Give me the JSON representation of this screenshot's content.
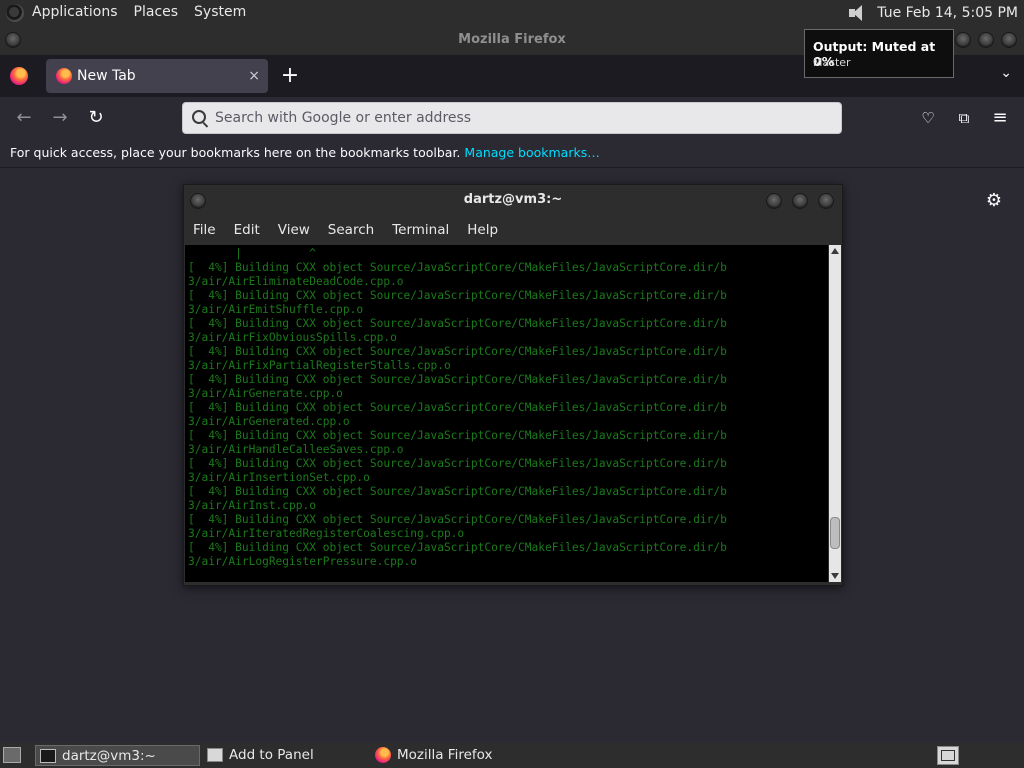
{
  "top_panel": {
    "menus": [
      "Applications",
      "Places",
      "System"
    ],
    "clock": "Tue Feb 14,  5:05 PM"
  },
  "volume_tooltip": {
    "title": "Output: Muted at 0%",
    "subtitle": "Master"
  },
  "firefox": {
    "window_title": "Mozilla Firefox",
    "tab_title": "New Tab",
    "tab_close": "×",
    "new_tab": "+",
    "list_all_tabs": "⌄",
    "nav": {
      "back": "←",
      "forward": "→",
      "reload": "↻"
    },
    "urlbar_placeholder": "Search with Google or enter address",
    "toolbar": {
      "pocket": "♡",
      "extensions": "⧉",
      "menu": "≡"
    },
    "bookmarks_bar_text": "For quick access, place your bookmarks here on the bookmarks toolbar.",
    "bookmarks_bar_link": "Manage bookmarks…",
    "settings_icon": "⚙"
  },
  "terminal": {
    "title": "dartz@vm3:~",
    "menus": [
      "File",
      "Edit",
      "View",
      "Search",
      "Terminal",
      "Help"
    ],
    "output": "       |          ^\n[  4%] Building CXX object Source/JavaScriptCore/CMakeFiles/JavaScriptCore.dir/b\n3/air/AirEliminateDeadCode.cpp.o\n[  4%] Building CXX object Source/JavaScriptCore/CMakeFiles/JavaScriptCore.dir/b\n3/air/AirEmitShuffle.cpp.o\n[  4%] Building CXX object Source/JavaScriptCore/CMakeFiles/JavaScriptCore.dir/b\n3/air/AirFixObviousSpills.cpp.o\n[  4%] Building CXX object Source/JavaScriptCore/CMakeFiles/JavaScriptCore.dir/b\n3/air/AirFixPartialRegisterStalls.cpp.o\n[  4%] Building CXX object Source/JavaScriptCore/CMakeFiles/JavaScriptCore.dir/b\n3/air/AirGenerate.cpp.o\n[  4%] Building CXX object Source/JavaScriptCore/CMakeFiles/JavaScriptCore.dir/b\n3/air/AirGenerated.cpp.o\n[  4%] Building CXX object Source/JavaScriptCore/CMakeFiles/JavaScriptCore.dir/b\n3/air/AirHandleCalleeSaves.cpp.o\n[  4%] Building CXX object Source/JavaScriptCore/CMakeFiles/JavaScriptCore.dir/b\n3/air/AirInsertionSet.cpp.o\n[  4%] Building CXX object Source/JavaScriptCore/CMakeFiles/JavaScriptCore.dir/b\n3/air/AirInst.cpp.o\n[  4%] Building CXX object Source/JavaScriptCore/CMakeFiles/JavaScriptCore.dir/b\n3/air/AirIteratedRegisterCoalescing.cpp.o\n[  4%] Building CXX object Source/JavaScriptCore/CMakeFiles/JavaScriptCore.dir/b\n3/air/AirLogRegisterPressure.cpp.o",
    "scroll_position": 0.92,
    "scroll_visible_fraction": 0.1
  },
  "taskbar": {
    "tasks": [
      "dartz@vm3:~",
      "Add to Panel",
      "Mozilla Firefox"
    ]
  },
  "colors": {
    "terminal_text": "#1b7a1b",
    "link": "#00ddff",
    "panel_bg": "#2d2d2d",
    "firefox_bg": "#2b2a33"
  }
}
